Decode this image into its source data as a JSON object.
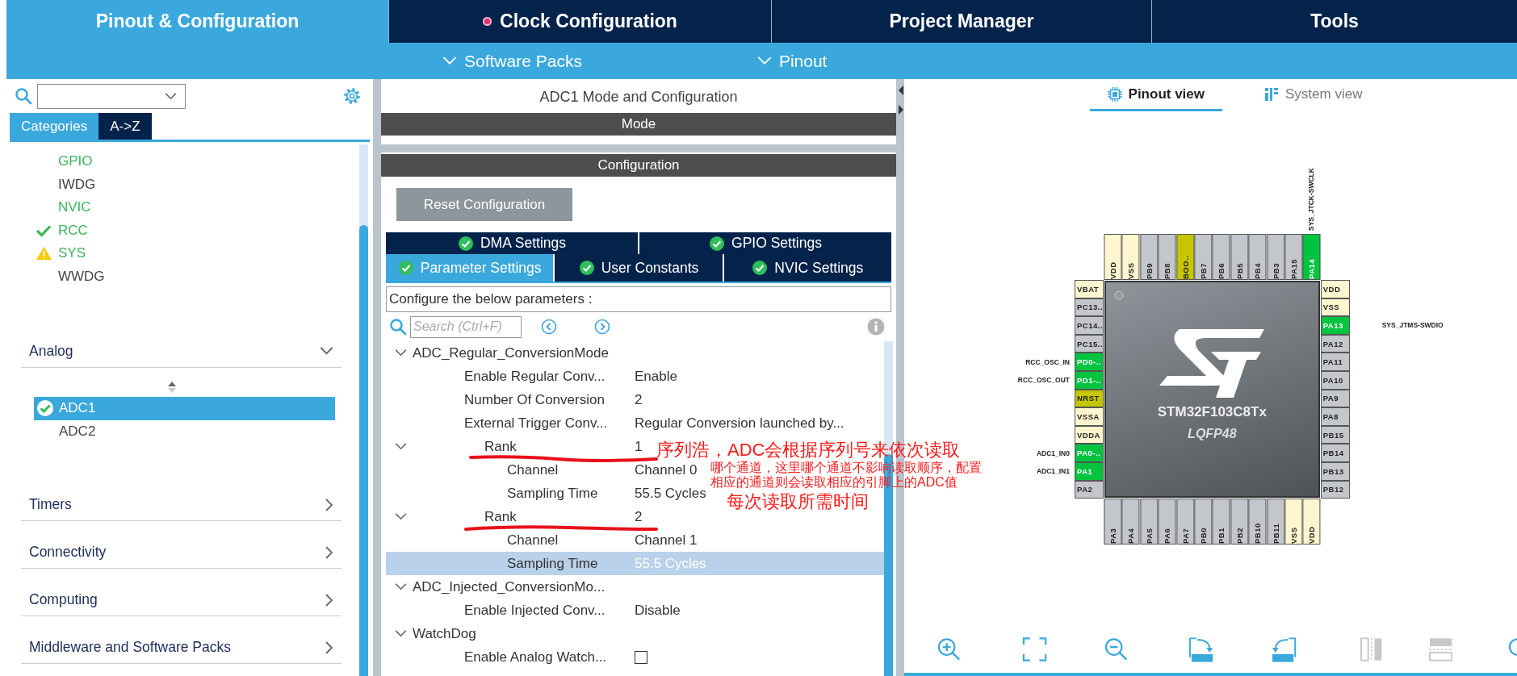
{
  "top_tabs": [
    {
      "label": "Pinout & Configuration",
      "selected": true,
      "flagged": false
    },
    {
      "label": "Clock Configuration",
      "selected": false,
      "flagged": true
    },
    {
      "label": "Project Manager",
      "selected": false,
      "flagged": false
    },
    {
      "label": "Tools",
      "selected": false,
      "flagged": false
    }
  ],
  "sub_menu": [
    {
      "label": "Software Packs"
    },
    {
      "label": "Pinout"
    }
  ],
  "sidebar": {
    "view_tabs": [
      {
        "label": "Categories",
        "selected": true
      },
      {
        "label": "A->Z",
        "selected": false
      }
    ],
    "items": [
      {
        "label": "GPIO",
        "configured": true,
        "kind": "plain"
      },
      {
        "label": "IWDG",
        "configured": false,
        "kind": "plain"
      },
      {
        "label": "NVIC",
        "configured": true,
        "kind": "plain"
      },
      {
        "label": "RCC",
        "configured": true,
        "kind": "check"
      },
      {
        "label": "SYS",
        "configured": true,
        "kind": "warning"
      },
      {
        "label": "WWDG",
        "configured": false,
        "kind": "plain"
      }
    ],
    "groups": [
      {
        "label": "Analog",
        "expanded": true,
        "items": [
          {
            "label": "ADC1",
            "selected": true,
            "kind": "check"
          },
          {
            "label": "ADC2",
            "selected": false,
            "kind": "plain"
          }
        ]
      },
      {
        "label": "Timers",
        "expanded": false
      },
      {
        "label": "Connectivity",
        "expanded": false
      },
      {
        "label": "Computing",
        "expanded": false
      },
      {
        "label": "Middleware and Software Packs",
        "expanded": false
      }
    ]
  },
  "mode_panel": {
    "title": "ADC1 Mode and Configuration",
    "mode_header": "Mode",
    "config_header": "Configuration",
    "reset_button": "Reset Configuration"
  },
  "config_tabs": [
    {
      "tabs": [
        {
          "label": "DMA Settings",
          "selected": false
        },
        {
          "label": "GPIO Settings",
          "selected": false
        }
      ]
    },
    {
      "tabs": [
        {
          "label": "Parameter Settings",
          "selected": true
        },
        {
          "label": "User Constants",
          "selected": false
        },
        {
          "label": "NVIC Settings",
          "selected": false
        }
      ]
    }
  ],
  "parameters": {
    "heading": "Configure the below parameters :",
    "search_placeholder": "Search (Ctrl+F)",
    "tree": [
      {
        "kind": "group",
        "label": "ADC_Regular_ConversionMode",
        "expanded": true,
        "selected": false,
        "children": [
          {
            "kind": "value",
            "label": "Enable Regular Conv...",
            "value": "Enable",
            "selected": false
          },
          {
            "kind": "value",
            "label": "Number Of Conversion",
            "value": "2",
            "selected": false
          },
          {
            "kind": "value",
            "label": "External Trigger Conv...",
            "value": "Regular Conversion launched by...",
            "selected": false
          },
          {
            "kind": "group",
            "label": "Rank",
            "value": "1",
            "expanded": true,
            "selected": false,
            "children": [
              {
                "kind": "value",
                "label": "Channel",
                "value": "Channel 0",
                "selected": false
              },
              {
                "kind": "value",
                "label": "Sampling Time",
                "value": "55.5 Cycles",
                "selected": false
              }
            ]
          },
          {
            "kind": "group",
            "label": "Rank",
            "value": "2",
            "expanded": true,
            "selected": false,
            "children": [
              {
                "kind": "value",
                "label": "Channel",
                "value": "Channel 1",
                "selected": false
              },
              {
                "kind": "value",
                "label": "Sampling Time",
                "value": "55.5 Cycles",
                "selected": true
              }
            ]
          }
        ]
      },
      {
        "kind": "group",
        "label": "ADC_Injected_ConversionMo...",
        "expanded": true,
        "selected": false,
        "children": [
          {
            "kind": "value",
            "label": "Enable Injected Conv...",
            "value": "Disable",
            "selected": false
          }
        ]
      },
      {
        "kind": "group",
        "label": "WatchDog",
        "expanded": true,
        "selected": false,
        "children": [
          {
            "kind": "checkbox",
            "label": "Enable Analog Watch...",
            "checked": false,
            "selected": false
          }
        ]
      }
    ]
  },
  "pinout": {
    "view_tabs": [
      {
        "label": "Pinout view",
        "selected": true
      },
      {
        "label": "System view",
        "selected": false
      }
    ],
    "chip": {
      "name": "STM32F103C8Tx",
      "package": "LQFP48",
      "top": [
        {
          "name": "VDD",
          "kind": "power"
        },
        {
          "name": "VSS",
          "kind": "power"
        },
        {
          "name": "PB9",
          "kind": "io"
        },
        {
          "name": "PB8",
          "kind": "io"
        },
        {
          "name": "BOO..",
          "kind": "fixed"
        },
        {
          "name": "PB7",
          "kind": "io"
        },
        {
          "name": "PB6",
          "kind": "io"
        },
        {
          "name": "PB5",
          "kind": "io"
        },
        {
          "name": "PB4",
          "kind": "io"
        },
        {
          "name": "PB3",
          "kind": "io"
        },
        {
          "name": "PA15",
          "kind": "io"
        },
        {
          "name": "PA14",
          "kind": "assigned",
          "signal": "SYS_JTCK-SWCLK"
        }
      ],
      "left": [
        {
          "name": "VBAT",
          "kind": "power"
        },
        {
          "name": "PC13..",
          "kind": "io"
        },
        {
          "name": "PC14..",
          "kind": "io"
        },
        {
          "name": "PC15..",
          "kind": "io"
        },
        {
          "name": "PD0-..",
          "kind": "assigned",
          "signal": "RCC_OSC_IN"
        },
        {
          "name": "PD1-..",
          "kind": "assigned",
          "signal": "RCC_OSC_OUT"
        },
        {
          "name": "NRST",
          "kind": "fixed"
        },
        {
          "name": "VSSA",
          "kind": "power"
        },
        {
          "name": "VDDA",
          "kind": "power"
        },
        {
          "name": "PA0-..",
          "kind": "assigned",
          "signal": "ADC1_IN0"
        },
        {
          "name": "PA1",
          "kind": "assigned",
          "signal": "ADC1_IN1"
        },
        {
          "name": "PA2",
          "kind": "io"
        }
      ],
      "right": [
        {
          "name": "VDD",
          "kind": "power"
        },
        {
          "name": "VSS",
          "kind": "power"
        },
        {
          "name": "PA13",
          "kind": "assigned",
          "signal": "SYS_JTMS-SWDIO"
        },
        {
          "name": "PA12",
          "kind": "io"
        },
        {
          "name": "PA11",
          "kind": "io"
        },
        {
          "name": "PA10",
          "kind": "io"
        },
        {
          "name": "PA9",
          "kind": "io"
        },
        {
          "name": "PA8",
          "kind": "io"
        },
        {
          "name": "PB15",
          "kind": "io"
        },
        {
          "name": "PB14",
          "kind": "io"
        },
        {
          "name": "PB13",
          "kind": "io"
        },
        {
          "name": "PB12",
          "kind": "io"
        }
      ],
      "bottom": [
        {
          "name": "PA3",
          "kind": "io"
        },
        {
          "name": "PA4",
          "kind": "io"
        },
        {
          "name": "PA5",
          "kind": "io"
        },
        {
          "name": "PA6",
          "kind": "io"
        },
        {
          "name": "PA7",
          "kind": "io"
        },
        {
          "name": "PB0",
          "kind": "io"
        },
        {
          "name": "PB1",
          "kind": "io"
        },
        {
          "name": "PB2",
          "kind": "io"
        },
        {
          "name": "PB10",
          "kind": "io"
        },
        {
          "name": "PB11",
          "kind": "io"
        },
        {
          "name": "VSS",
          "kind": "power"
        },
        {
          "name": "VDD",
          "kind": "power"
        }
      ]
    }
  },
  "annotations": [
    {
      "text": "序列浩，ADC会根据序列号来依次读取"
    },
    {
      "text": "哪个通道，这里哪个通道不影响读取顺序，配置相应的通道则会读取相应的引脚上的ADC值"
    },
    {
      "text": "每次读取所需时间"
    }
  ]
}
